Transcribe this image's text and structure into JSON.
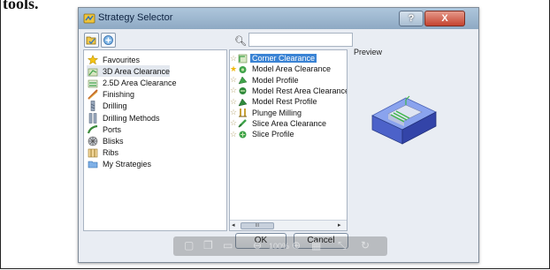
{
  "document": {
    "caption_fragment": "tools."
  },
  "dialog": {
    "title": "Strategy Selector",
    "help_label": "?",
    "close_label": "X",
    "toolbar": {
      "icon1": "folder-open-icon",
      "icon2": "add-strategy-icon"
    }
  },
  "search": {
    "icon": "search-icon",
    "value": "",
    "placeholder": ""
  },
  "categories": [
    {
      "label": "Favourites",
      "icon": "star-icon",
      "selected": false
    },
    {
      "label": "3D Area Clearance",
      "icon": "3d-area-clearance-icon",
      "selected": true
    },
    {
      "label": "2.5D Area Clearance",
      "icon": "2-5d-area-clearance-icon",
      "selected": false
    },
    {
      "label": "Finishing",
      "icon": "finishing-icon",
      "selected": false
    },
    {
      "label": "Drilling",
      "icon": "drilling-icon",
      "selected": false
    },
    {
      "label": "Drilling Methods",
      "icon": "drilling-methods-icon",
      "selected": false
    },
    {
      "label": "Ports",
      "icon": "ports-icon",
      "selected": false
    },
    {
      "label": "Blisks",
      "icon": "blisks-icon",
      "selected": false
    },
    {
      "label": "Ribs",
      "icon": "ribs-icon",
      "selected": false
    },
    {
      "label": "My Strategies",
      "icon": "my-strategies-icon",
      "selected": false
    }
  ],
  "strategies": [
    {
      "label": "Corner Clearance",
      "favourite": false,
      "selected": true
    },
    {
      "label": "Model Area Clearance",
      "favourite": true,
      "selected": false
    },
    {
      "label": "Model Profile",
      "favourite": false,
      "selected": false
    },
    {
      "label": "Model Rest Area Clearance",
      "favourite": false,
      "selected": false
    },
    {
      "label": "Model Rest Profile",
      "favourite": false,
      "selected": false
    },
    {
      "label": "Plunge Milling",
      "favourite": false,
      "selected": false
    },
    {
      "label": "Slice Area Clearance",
      "favourite": false,
      "selected": false
    },
    {
      "label": "Slice Profile",
      "favourite": false,
      "selected": false
    }
  ],
  "scrollbar": {
    "left": "◂",
    "right": "▸",
    "thumb": "III"
  },
  "preview": {
    "label": "Preview"
  },
  "buttons": {
    "ok": "OK",
    "cancel": "Cancel"
  },
  "viewer_bar": {
    "zoom": "100%"
  },
  "colors": {
    "selection": "#3a83d4",
    "favourite_star": "#f0b80c"
  }
}
